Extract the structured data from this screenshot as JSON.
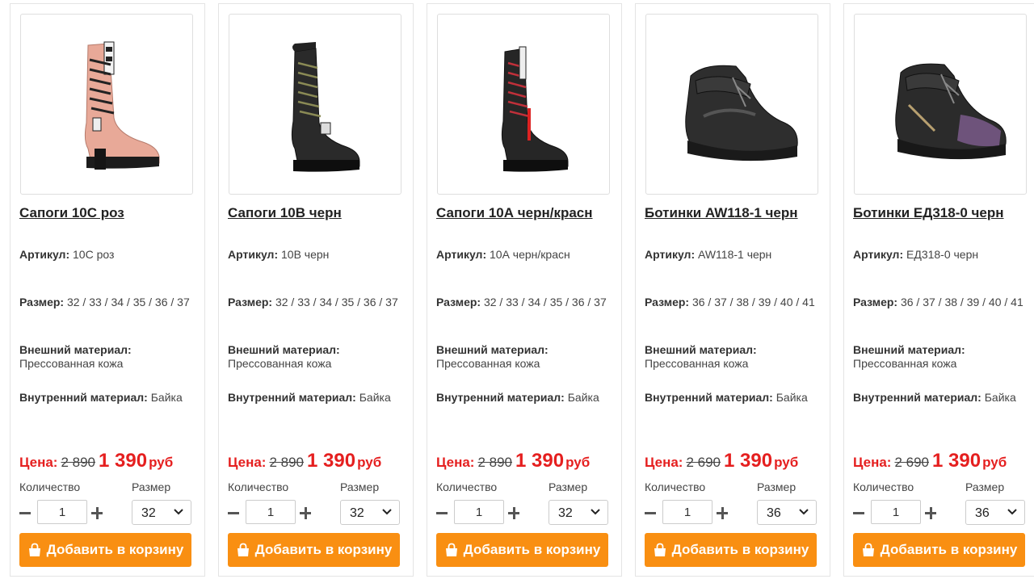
{
  "labels": {
    "article": "Артикул:",
    "size": "Размер:",
    "outer": "Внешний материал:",
    "inner": "Внутренний материал:",
    "price": "Цена:",
    "currency": "руб",
    "quantity": "Количество",
    "size_select": "Размер",
    "add_to_cart": "Добавить в корзину"
  },
  "colors": {
    "accent": "#f98f12",
    "price_red": "#e51f1f"
  },
  "products": [
    {
      "title": "Сапоги 10С роз",
      "article": "10С роз",
      "sizes": "32 / 33 / 34 / 35 / 36 / 37",
      "outer": "Прессованная кожа",
      "inner": "Байка",
      "old_price": "2 890",
      "new_price": "1 390",
      "qty": "1",
      "selected_size": "32",
      "image": "pink-lace-up-boot"
    },
    {
      "title": "Сапоги 10В черн",
      "article": "10В черн",
      "sizes": "32 / 33 / 34 / 35 / 36 / 37",
      "outer": "Прессованная кожа",
      "inner": "Байка",
      "old_price": "2 890",
      "new_price": "1 390",
      "qty": "1",
      "selected_size": "32",
      "image": "black-lace-up-boot"
    },
    {
      "title": "Сапоги 10А черн/красн",
      "article": "10А черн/красн",
      "sizes": "32 / 33 / 34 / 35 / 36 / 37",
      "outer": "Прессованная кожа",
      "inner": "Байка",
      "old_price": "2 890",
      "new_price": "1 390",
      "qty": "1",
      "selected_size": "32",
      "image": "black-red-lace-up-boot"
    },
    {
      "title": "Ботинки AW118-1 черн",
      "article": "AW118-1 черн",
      "sizes": "36 / 37 / 38 / 39 / 40 / 41",
      "outer": "Прессованная кожа",
      "inner": "Байка",
      "old_price": "2 690",
      "new_price": "1 390",
      "qty": "1",
      "selected_size": "36",
      "image": "black-sport-boot"
    },
    {
      "title": "Ботинки ЕД318-0 черн",
      "article": "ЕД318-0 черн",
      "sizes": "36 / 37 / 38 / 39 / 40 / 41",
      "outer": "Прессованная кожа",
      "inner": "Байка",
      "old_price": "2 690",
      "new_price": "1 390",
      "qty": "1",
      "selected_size": "36",
      "image": "black-iridescent-boot"
    }
  ]
}
